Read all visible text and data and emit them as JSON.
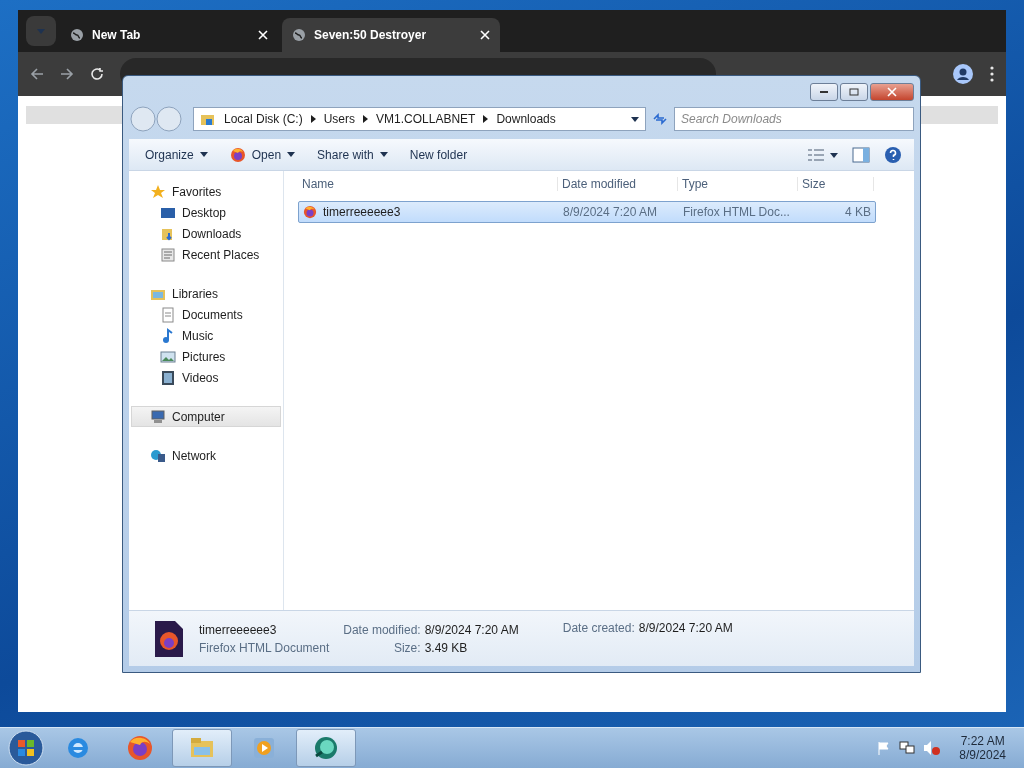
{
  "browser": {
    "tabs": [
      {
        "label": "New Tab",
        "selected": false
      },
      {
        "label": "Seven:50 Destroyer",
        "selected": true
      }
    ]
  },
  "explorer": {
    "breadcrumb": [
      "Local Disk (C:)",
      "Users",
      "VM1.COLLABNET",
      "Downloads"
    ],
    "search": {
      "placeholder": "Search Downloads"
    },
    "toolbar": [
      {
        "label": "Organize",
        "dropdown": true,
        "kind": "plain"
      },
      {
        "label": "Open",
        "dropdown": true,
        "kind": "firefox"
      },
      {
        "label": "Share with",
        "dropdown": true,
        "kind": "plain"
      },
      {
        "label": "New folder",
        "dropdown": false,
        "kind": "plain"
      }
    ],
    "nav": [
      {
        "label": "Favorites",
        "kind": "star",
        "selected": false,
        "children": [
          {
            "label": "Desktop",
            "kind": "desktop",
            "selected": false
          },
          {
            "label": "Downloads",
            "kind": "downloads",
            "selected": false
          },
          {
            "label": "Recent Places",
            "kind": "recent",
            "selected": false
          }
        ]
      },
      {
        "label": "Libraries",
        "kind": "libraries",
        "selected": false,
        "children": [
          {
            "label": "Documents",
            "kind": "document",
            "selected": false
          },
          {
            "label": "Music",
            "kind": "music",
            "selected": false
          },
          {
            "label": "Pictures",
            "kind": "pictures",
            "selected": false
          },
          {
            "label": "Videos",
            "kind": "videos",
            "selected": false
          }
        ]
      },
      {
        "label": "Computer",
        "kind": "computer",
        "selected": true
      },
      {
        "label": "Network",
        "kind": "network",
        "selected": false
      }
    ],
    "columns": [
      "Name",
      "Date modified",
      "Type",
      "Size"
    ],
    "rows": [
      {
        "name": "timerreeeeee3",
        "date": "8/9/2024 7:20 AM",
        "type": "Firefox HTML Doc...",
        "size": "4 KB",
        "selected": true
      }
    ],
    "details": {
      "name": "timerreeeeee3",
      "type": "Firefox HTML Document",
      "fields": [
        {
          "label": "Date modified:",
          "value": "8/9/2024 7:20 AM"
        },
        {
          "label": "Size:",
          "value": "3.49 KB"
        },
        {
          "label": "Date created:",
          "value": "8/9/2024 7:20 AM"
        }
      ]
    }
  },
  "taskbar": {
    "apps": [
      {
        "kind": "ie",
        "active": false
      },
      {
        "kind": "firefox",
        "active": false
      },
      {
        "kind": "folder",
        "active": true
      },
      {
        "kind": "media",
        "active": false
      },
      {
        "kind": "green",
        "active": true
      }
    ],
    "time": "7:22 AM",
    "date": "8/9/2024"
  }
}
